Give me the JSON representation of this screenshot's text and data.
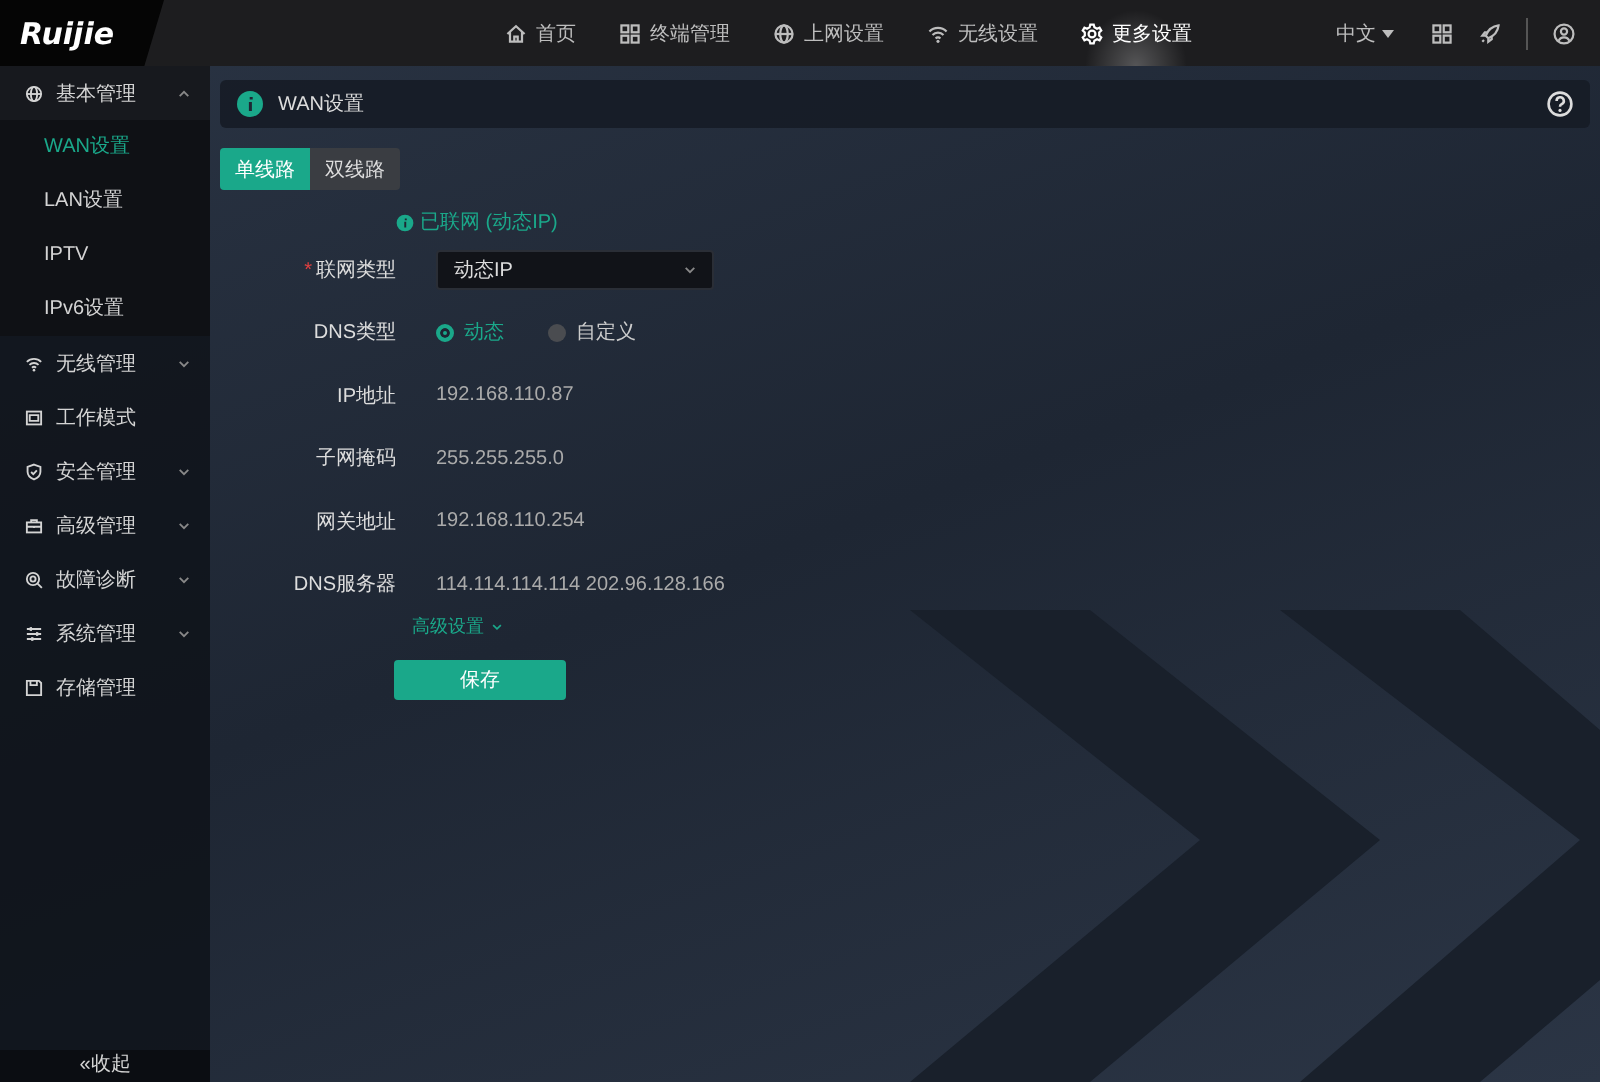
{
  "topbar": {
    "logo": "Ruijie",
    "nav": [
      {
        "label": "首页",
        "selected": false
      },
      {
        "label": "终端管理",
        "selected": false
      },
      {
        "label": "上网设置",
        "selected": false
      },
      {
        "label": "无线设置",
        "selected": false
      },
      {
        "label": "更多设置",
        "selected": true
      }
    ],
    "language": "中文"
  },
  "sidebar": {
    "items": [
      {
        "label": "基本管理",
        "kind": "group",
        "expanded": true,
        "children": [
          {
            "label": "WAN设置",
            "selected": true
          },
          {
            "label": "LAN设置",
            "selected": false
          },
          {
            "label": "IPTV",
            "selected": false
          },
          {
            "label": "IPv6设置",
            "selected": false
          }
        ]
      },
      {
        "label": "无线管理",
        "kind": "group",
        "expanded": false
      },
      {
        "label": "工作模式",
        "kind": "link"
      },
      {
        "label": "安全管理",
        "kind": "group",
        "expanded": false
      },
      {
        "label": "高级管理",
        "kind": "group",
        "expanded": false
      },
      {
        "label": "故障诊断",
        "kind": "group",
        "expanded": false
      },
      {
        "label": "系统管理",
        "kind": "group",
        "expanded": false
      },
      {
        "label": "存储管理",
        "kind": "link"
      }
    ],
    "collapse": "«收起"
  },
  "page": {
    "title": "WAN设置",
    "tabs": [
      {
        "label": "单线路",
        "selected": true
      },
      {
        "label": "双线路",
        "selected": false
      }
    ],
    "status": "已联网 (动态IP)",
    "fields": [
      {
        "kind": "select",
        "label": "联网类型",
        "required_mark": "*",
        "value": "动态IP"
      },
      {
        "kind": "radio",
        "label": "DNS类型",
        "options": [
          {
            "label": "动态",
            "selected": true
          },
          {
            "label": "自定义",
            "selected": false
          }
        ]
      },
      {
        "kind": "text",
        "label": "IP地址",
        "value": "192.168.110.87"
      },
      {
        "kind": "text",
        "label": "子网掩码",
        "value": "255.255.255.0"
      },
      {
        "kind": "text",
        "label": "网关地址",
        "value": "192.168.110.254"
      },
      {
        "kind": "text",
        "label": "DNS服务器",
        "value": "114.114.114.114 202.96.128.166"
      }
    ],
    "advanced": "高级设置",
    "save": "保存"
  }
}
